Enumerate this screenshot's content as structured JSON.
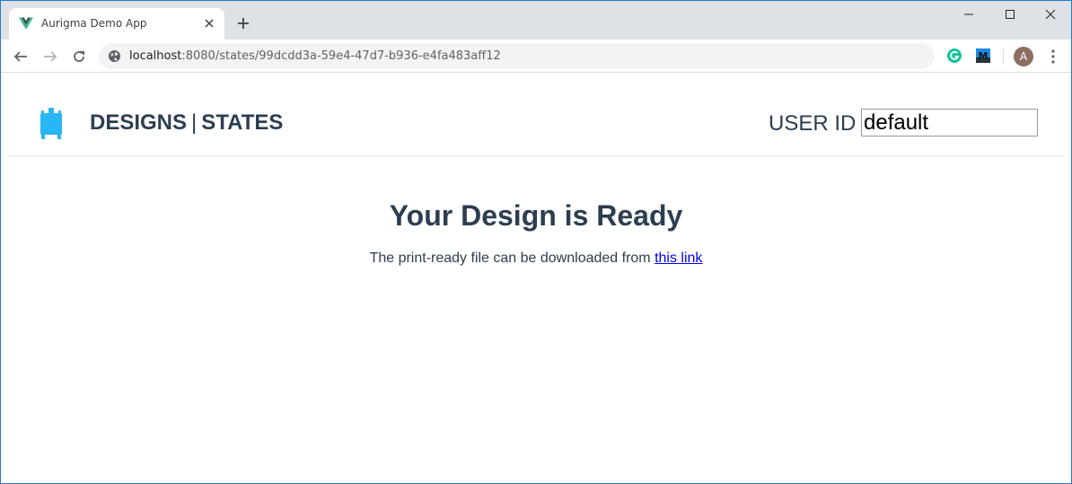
{
  "browser": {
    "tab_title": "Aurigma Demo App",
    "url_host": "localhost",
    "url_rest": ":8080/states/99dcdd3a-59e4-47d7-b936-e4fa483aff12",
    "avatar_letter": "A",
    "extensions": [
      "grammarly-icon",
      "m-extension-icon"
    ]
  },
  "header": {
    "designs_label": "DESIGNS",
    "divider": "|",
    "states_label": "STATES",
    "user_id_label": "USER ID",
    "user_id_value": "default"
  },
  "main": {
    "title": "Your Design is Ready",
    "text": "The print-ready file can be downloaded from",
    "link_text": "this link"
  },
  "colors": {
    "heading": "#2c3e50",
    "logo": "#29b6f6",
    "link": "#0000ee"
  }
}
